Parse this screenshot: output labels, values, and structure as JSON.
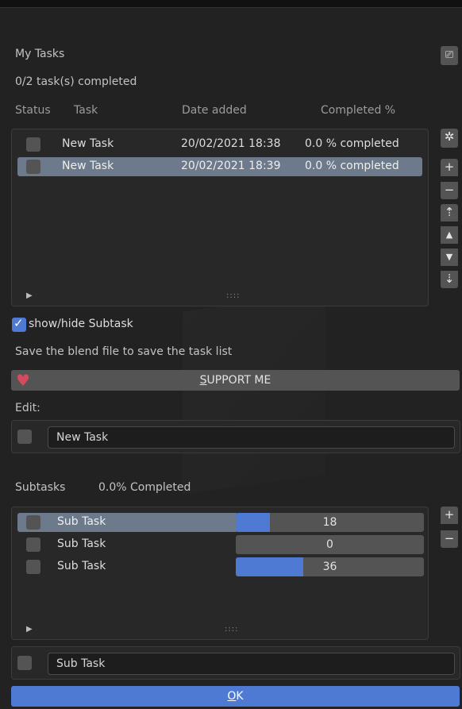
{
  "header": {
    "title": "My Tasks",
    "progress": "0/2 task(s) completed"
  },
  "columns": {
    "status": "Status",
    "task": "Task",
    "date": "Date added",
    "completed": "Completed %"
  },
  "tasks": [
    {
      "checked": false,
      "name": "New Task",
      "date": "20/02/2021 18:38",
      "completed": "0.0 % completed",
      "selected": false
    },
    {
      "checked": false,
      "name": "New Task",
      "date": "20/02/2021 18:39",
      "completed": "0.0 % completed",
      "selected": true
    }
  ],
  "list_grip": "::::",
  "task_side_buttons": [
    "gear-icon",
    "plus-icon",
    "minus-icon",
    "move-top-icon",
    "up-icon",
    "down-icon",
    "move-bottom-icon"
  ],
  "toggle": {
    "label": "show/hide Subtask",
    "checked": true
  },
  "hint": "Save the blend file to save the task list",
  "support_label": "SUPPORT ME",
  "support_underline_char": "S",
  "support_rest": "UPPORT ME",
  "edit": {
    "label": "Edit:",
    "value": "New Task"
  },
  "subtasks_header": {
    "label": "Subtasks",
    "completed": "0.0% Completed"
  },
  "subtasks": [
    {
      "checked": false,
      "name": "Sub Task",
      "value": 18,
      "display": "18",
      "selected": true
    },
    {
      "checked": false,
      "name": "Sub Task",
      "value": 0,
      "display": "0",
      "selected": false
    },
    {
      "checked": false,
      "name": "Sub Task",
      "value": 36,
      "display": "36",
      "selected": false
    }
  ],
  "subtask_edit_value": "Sub Task",
  "ok_label_underline": "O",
  "ok_label_rest": "K",
  "colors": {
    "accent": "#4e7ad3",
    "selection": "#6d7a8c",
    "heart": "#d64a5f",
    "background": "#222222"
  }
}
